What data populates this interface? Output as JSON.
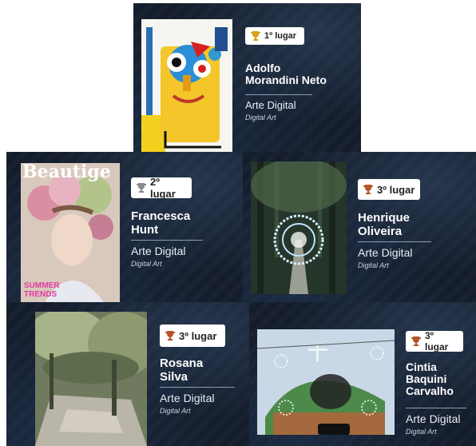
{
  "entries": [
    {
      "place": "1º lugar",
      "name_line1": "Adolfo",
      "name_line2": "Morandini Neto",
      "name_line3": "",
      "category": "Arte Digital",
      "category_en": "Digital Art",
      "art_title": "",
      "art_subtitle": "",
      "trophy_color": "#d8a21e"
    },
    {
      "place": "2º lugar",
      "name_line1": "Francesca",
      "name_line2": "Hunt",
      "name_line3": "",
      "category": "Arte Digital",
      "category_en": "Digital Art",
      "art_title": "Beautige",
      "art_subtitle": "SUMMER TRENDS",
      "trophy_color": "#8a8a8a"
    },
    {
      "place": "3º lugar",
      "name_line1": "Henrique",
      "name_line2": "Oliveira",
      "name_line3": "",
      "category": "Arte Digital",
      "category_en": "Digital Art",
      "art_title": "",
      "art_subtitle": "",
      "trophy_color": "#b5542c"
    },
    {
      "place": "3º lugar",
      "name_line1": "Rosana",
      "name_line2": "Silva",
      "name_line3": "",
      "category": "Arte Digital",
      "category_en": "Digital Art",
      "art_title": "",
      "art_subtitle": "",
      "trophy_color": "#b5542c"
    },
    {
      "place": "3º lugar",
      "name_line1": "Cintia",
      "name_line2": "Baquini",
      "name_line3": "Carvalho",
      "category": "Arte Digital",
      "category_en": "Digital Art",
      "art_title": "",
      "art_subtitle": "",
      "trophy_color": "#b5542c"
    }
  ],
  "colors": {
    "card_bg": "#141d2c",
    "badge_bg": "#ffffff",
    "text": "#ffffff"
  }
}
